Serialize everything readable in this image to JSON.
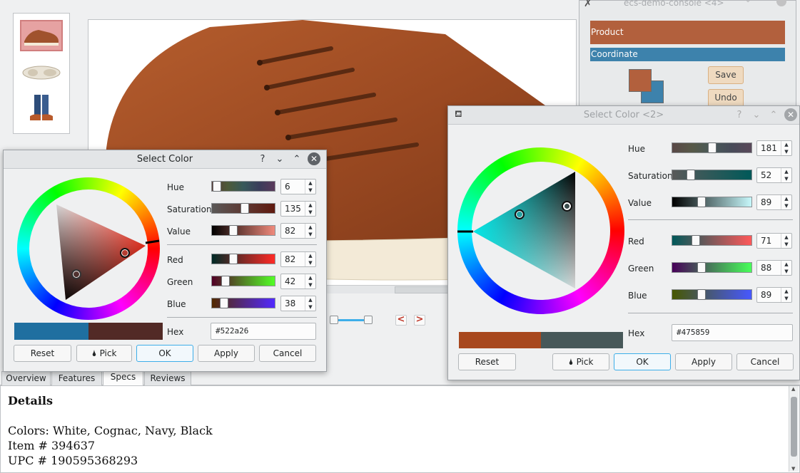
{
  "main": {
    "tabs": [
      "Overview",
      "Features",
      "Specs",
      "Reviews"
    ],
    "active_tab": "Specs",
    "details": {
      "heading": "Details",
      "colors": "Colors: White, Cognac, Navy, Black",
      "item": "Item # 394637",
      "upc": "UPC # 190595368293"
    },
    "nav": {
      "prev": "<",
      "next": ">"
    }
  },
  "console": {
    "title": "ecs-demo-console <4>",
    "product_label": "Product",
    "coordinate_label": "Coordinate",
    "save": "Save",
    "undo": "Undo",
    "colors": {
      "product": "#a8481e",
      "coordinate": "#1f6fa0"
    }
  },
  "dialog1": {
    "title": "Select Color",
    "help": "?",
    "fields": [
      {
        "label": "Hue",
        "value": "6",
        "level": 0.02
      },
      {
        "label": "Saturation",
        "value": "135",
        "level": 0.53
      },
      {
        "label": "Value",
        "value": "82",
        "level": 0.32
      }
    ],
    "rgb": [
      {
        "label": "Red",
        "value": "82",
        "level": 0.32
      },
      {
        "label": "Green",
        "value": "42",
        "level": 0.16
      },
      {
        "label": "Blue",
        "value": "38",
        "level": 0.15
      }
    ],
    "hex_label": "Hex",
    "hex": "#522a26",
    "old_color": "#1f6fa0",
    "new_color": "#522a26",
    "buttons": {
      "reset": "Reset",
      "pick": "Pick",
      "ok": "OK",
      "apply": "Apply",
      "cancel": "Cancel"
    }
  },
  "dialog2": {
    "title": "Select Color <2>",
    "help": "?",
    "fields": [
      {
        "label": "Hue",
        "value": "181",
        "level": 0.5
      },
      {
        "label": "Saturation",
        "value": "52",
        "level": 0.2
      },
      {
        "label": "Value",
        "value": "89",
        "level": 0.35
      }
    ],
    "rgb": [
      {
        "label": "Red",
        "value": "71",
        "level": 0.28
      },
      {
        "label": "Green",
        "value": "88",
        "level": 0.35
      },
      {
        "label": "Blue",
        "value": "89",
        "level": 0.35
      }
    ],
    "hex_label": "Hex",
    "hex": "#475859",
    "old_color": "#a8481e",
    "new_color": "#475859",
    "buttons": {
      "reset": "Reset",
      "pick": "Pick",
      "ok": "OK",
      "apply": "Apply",
      "cancel": "Cancel"
    }
  }
}
